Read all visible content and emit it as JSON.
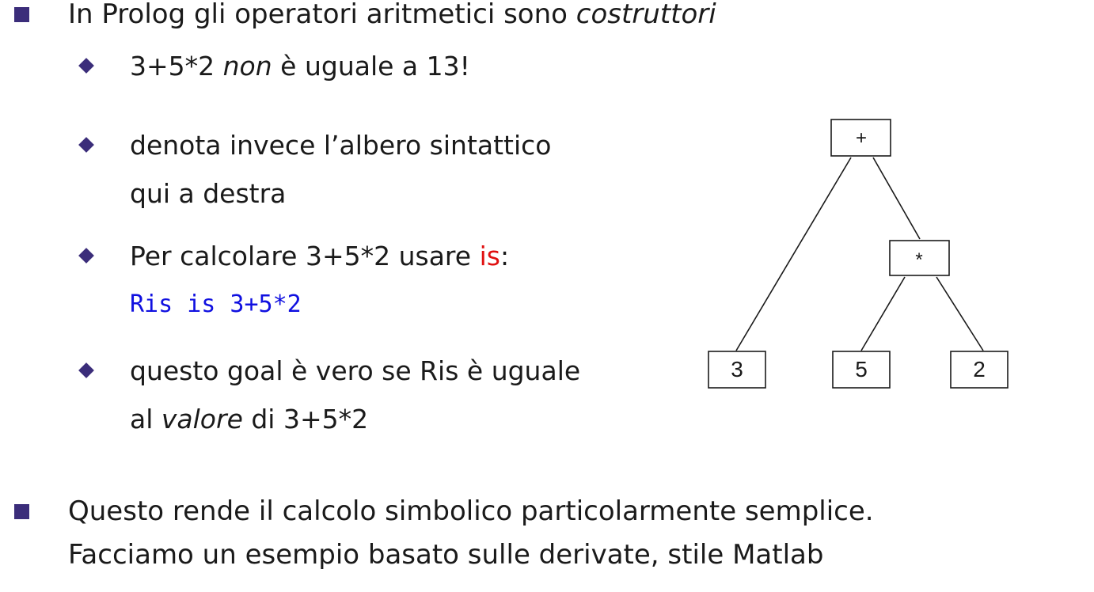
{
  "slide": {
    "bullet1": {
      "pre": "In Prolog gli operatori aritmetici sono ",
      "em": "costruttori"
    },
    "sub1": {
      "pre": "3+5*2 ",
      "em": "non",
      "post": " è uguale a 13!"
    },
    "sub2": {
      "line1": "denota  invece  l’albero  sintattico",
      "line2": "qui a destra"
    },
    "sub3": {
      "pre": "Per calcolare 3+5*2 usare ",
      "kw": "is",
      "post": ":",
      "code": "Ris is 3+5*2"
    },
    "sub4": {
      "line1": "questo goal è vero se Ris è uguale",
      "line2_pre": "al ",
      "line2_em": "valore",
      "line2_post": " di 3+5*2"
    },
    "bullet2": {
      "line1": "Questo rende il calcolo simbolico particolarmente semplice.",
      "line2": "Facciamo un esempio basato sulle derivate, stile Matlab"
    }
  },
  "tree": {
    "root": "+",
    "mult": "*",
    "leaf_left": "3",
    "leaf_mid": "5",
    "leaf_right": "2"
  },
  "colors": {
    "bullet": "#3b2d7a",
    "keyword": "#e01010",
    "code": "#1010e0"
  }
}
